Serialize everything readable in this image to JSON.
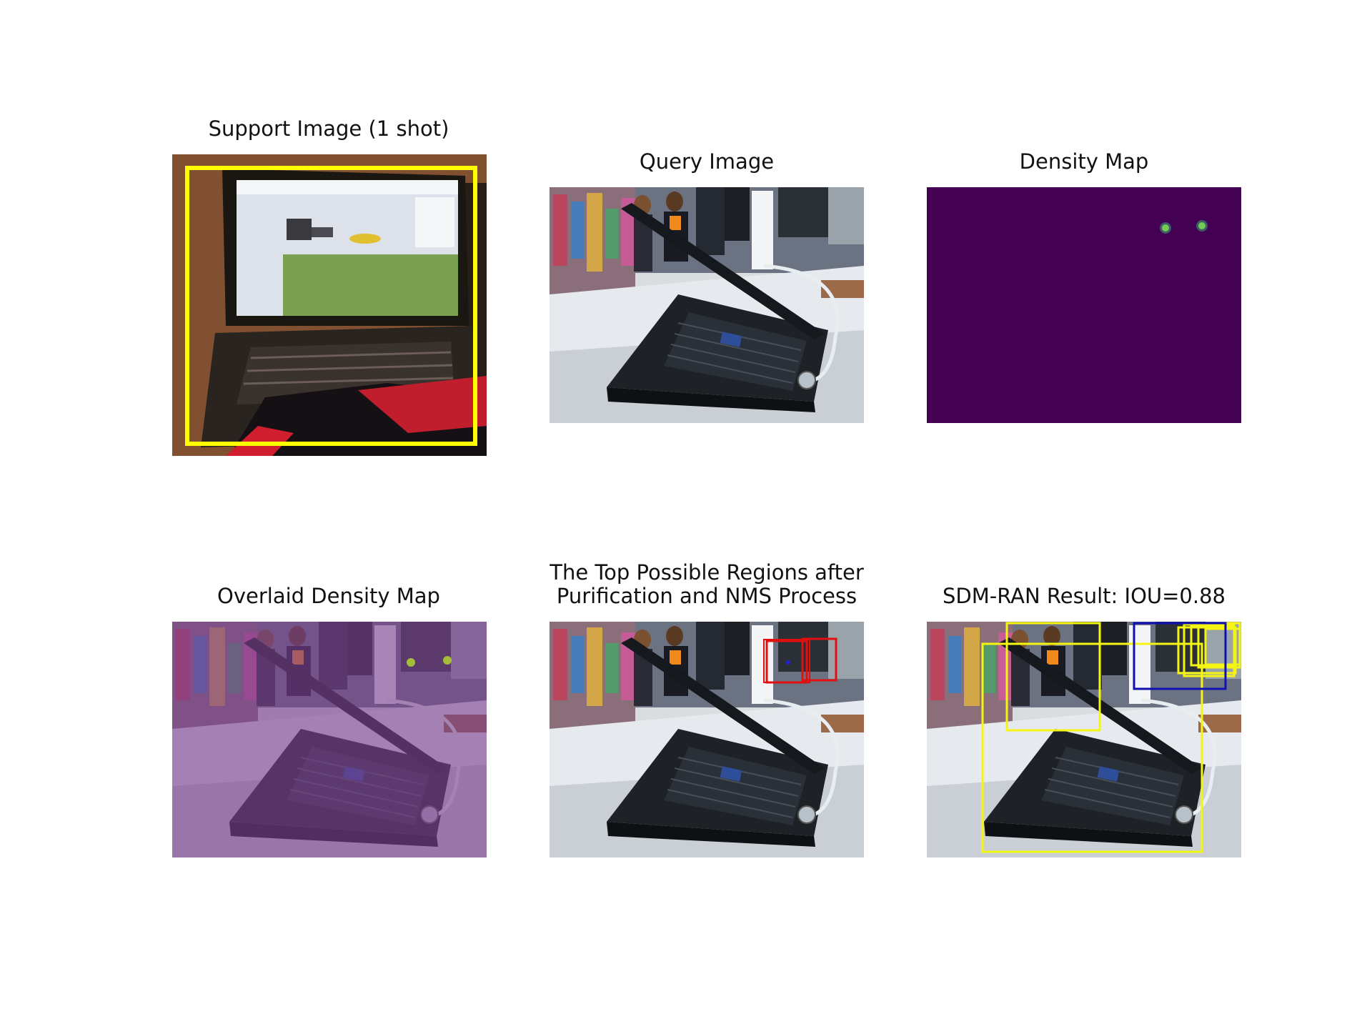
{
  "figure": {
    "panels": [
      {
        "id": "support",
        "title": "Support Image (1 shot)"
      },
      {
        "id": "query",
        "title": "Query Image"
      },
      {
        "id": "density",
        "title": "Density Map"
      },
      {
        "id": "overlaid",
        "title": "Overlaid Density Map"
      },
      {
        "id": "regions",
        "title_lines": [
          "The Top Possible Regions after",
          "Purification and NMS Process"
        ]
      },
      {
        "id": "result",
        "title": "SDM-RAN Result: IOU=0.88"
      }
    ]
  },
  "colors": {
    "support_box": "#ffff00",
    "region_box": "#e01010",
    "density_bg": "#440154",
    "density_peak": "#b5de2b",
    "result_pred_box": "#f5f514",
    "result_gt_box": "#1010b0",
    "overlay_tint": "#7b3f8f"
  },
  "icons": [
    "laptop-photo",
    "density-heatmap"
  ]
}
